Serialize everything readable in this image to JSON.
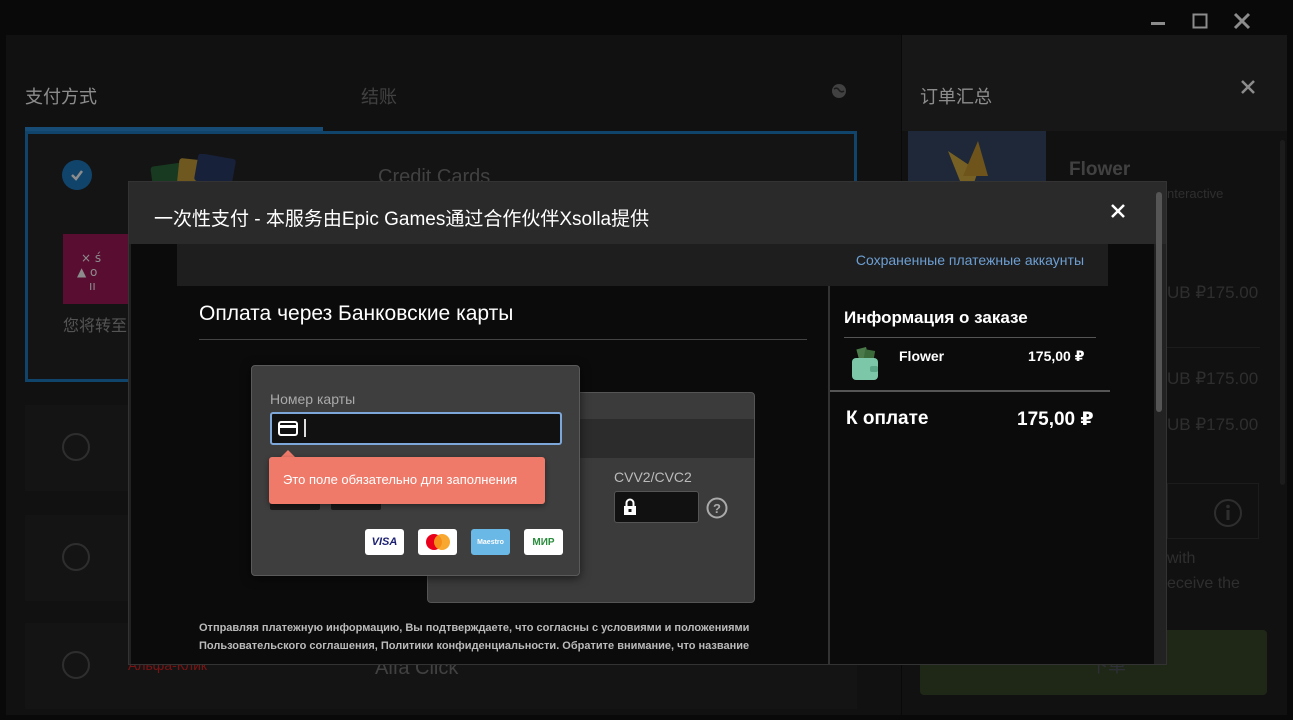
{
  "window": {
    "controls": {
      "minimize": "minimize",
      "maximize": "maximize",
      "close": "close"
    }
  },
  "checkout": {
    "tabs": [
      {
        "label": "支付方式",
        "active": true
      },
      {
        "label": "结账",
        "active": false
      }
    ],
    "payment_methods": [
      {
        "label": "Credit Cards",
        "selected": true
      },
      {
        "label": "",
        "selected": false
      },
      {
        "label": "",
        "selected": false
      },
      {
        "label": "Alfa Click",
        "selected": false,
        "brand_label": "Альфа-Клик"
      }
    ],
    "redirect_text": "您将转至"
  },
  "summary": {
    "title": "订单汇总",
    "product_name": "Flower",
    "developer": "nteractive",
    "prices": [
      "UB ₽175.00",
      "UB ₽175.00",
      "UB ₽175.00"
    ],
    "note_lines": [
      "with",
      "eceive the"
    ],
    "button_label": "下单"
  },
  "modal": {
    "title": "一次性支付 - 本服务由Epic Games通过合作伙伴Xsolla提供",
    "saved_accounts_link": "Сохраненные платежные аккаунты",
    "heading": "Оплата через Банковские карты",
    "card_number_label": "Номер карты",
    "card_number_value": "",
    "error_message": "Это поле обязательно для заполнения",
    "cvv_label": "CVV2/CVC2",
    "card_logos": [
      "VISA",
      "Mastercard",
      "Maestro",
      "МИР"
    ],
    "legal_text": "Отправляя платежную информацию, Вы подтверждаете, что согласны с условиями и положениями Пользовательского соглашения, Политики конфиденциальности. Обратите внимание, что название",
    "order": {
      "title": "Информация о заказе",
      "item_name": "Flower",
      "item_price": "175,00 ₽",
      "total_label": "К оплате",
      "total_value": "175,00 ₽"
    }
  },
  "colors": {
    "accent_blue": "#1f7cc4",
    "error_bg": "#f07a6a",
    "link": "#6d9fd3"
  }
}
